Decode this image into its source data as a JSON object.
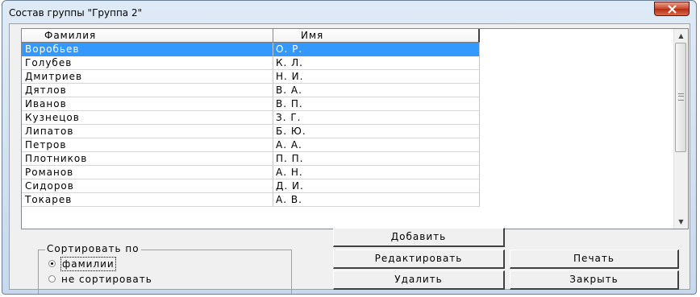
{
  "window": {
    "title": "Состав группы \"Группа 2\""
  },
  "table": {
    "headers": [
      "Фамилия",
      "Имя"
    ],
    "rows": [
      [
        "Воробьев",
        "О. Р."
      ],
      [
        "Голубев",
        "К. Л."
      ],
      [
        "Дмитриев",
        "Н. И."
      ],
      [
        "Дятлов",
        "В. А."
      ],
      [
        "Иванов",
        "В. П."
      ],
      [
        "Кузнецов",
        "З. Г."
      ],
      [
        "Липатов",
        "Б. Ю."
      ],
      [
        "Петров",
        "А. А."
      ],
      [
        "Плотников",
        "П. П."
      ],
      [
        "Романов",
        "А. Н."
      ],
      [
        "Сидоров",
        "Д. И."
      ],
      [
        "Токарев",
        "А. В."
      ]
    ],
    "selected_row": 0
  },
  "sort": {
    "legend": "Сортировать по",
    "options": [
      "фамилии",
      "не сортировать"
    ],
    "selected": 0
  },
  "buttons": {
    "add": "Добавить",
    "edit": "Редактировать",
    "print": "Печать",
    "delete": "Удалить",
    "close": "Закрыть"
  },
  "colors": {
    "selection": "#3399ff",
    "close_button": "#c8452c"
  },
  "icons": {
    "close": "close-icon",
    "scroll_up": "scroll-up-arrow-icon",
    "scroll_down": "scroll-down-arrow-icon"
  }
}
